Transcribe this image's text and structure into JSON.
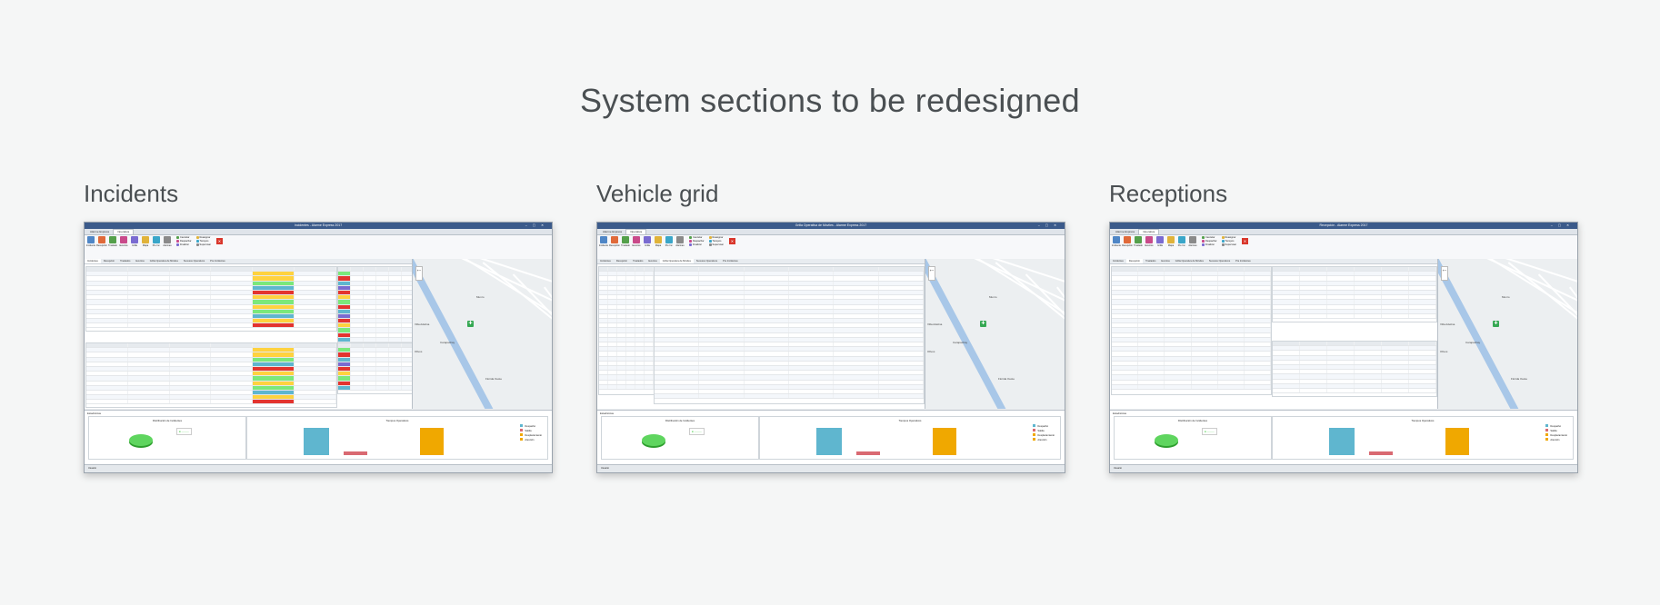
{
  "page_title": "System sections to be redesigned",
  "sections": [
    {
      "label": "Incidents",
      "window_title": "Incidentes - Alarme Express 2017",
      "menu_tabs": [
        "Alarme Express",
        "Operativa"
      ],
      "pane_tabs": [
        "Incidentes",
        "Recepción",
        "Traslados",
        "Eventos",
        "Grilla Operativa de Móviles",
        "Sucesos Operativos",
        "Pre Incidentes"
      ],
      "map_labels": [
        "Villa Adelina",
        "Carapachay",
        "Munro",
        "Florida Oeste",
        "Olivos"
      ],
      "stats_title": "Estadísticas",
      "pie_title": "Distribución de Incidentes",
      "bar_title": "Tiempos Operativos",
      "bar_legend": [
        "Despacho",
        "Salida",
        "Desplazamiento",
        "Atención"
      ],
      "statusbar": "Usuario"
    },
    {
      "label": "Vehicle grid",
      "window_title": "Grilla Operativa de Móviles - Alarme Express 2017",
      "menu_tabs": [
        "Alarme Express",
        "Operativa"
      ],
      "pane_tabs": [
        "Incidentes",
        "Recepción",
        "Traslados",
        "Eventos",
        "Grilla Operativa de Móviles",
        "Sucesos Operativos",
        "Pre Incidentes"
      ],
      "map_labels": [
        "Villa Adelina",
        "Carapachay",
        "Munro",
        "Florida Oeste",
        "Olivos"
      ],
      "stats_title": "Estadísticas",
      "pie_title": "Distribución de Incidentes",
      "bar_title": "Tiempos Operativos",
      "bar_legend": [
        "Despacho",
        "Salida",
        "Desplazamiento",
        "Atención"
      ],
      "statusbar": "Usuario"
    },
    {
      "label": "Receptions",
      "window_title": "Recepción - Alarme Express 2017",
      "menu_tabs": [
        "Alarme Express",
        "Operativa"
      ],
      "pane_tabs": [
        "Incidentes",
        "Recepción",
        "Traslados",
        "Eventos",
        "Grilla Operativa de Móviles",
        "Sucesos Operativos",
        "Pre Incidentes"
      ],
      "map_labels": [
        "Villa Adelina",
        "Carapachay",
        "Munro",
        "Florida Oeste",
        "Olivos"
      ],
      "stats_title": "Estadísticas",
      "pie_title": "Distribución de Incidentes",
      "bar_title": "Tiempos Operativos",
      "bar_legend": [
        "Despacho",
        "Salida",
        "Desplazamiento",
        "Atención"
      ],
      "statusbar": "Usuario"
    }
  ],
  "ribbon": {
    "buttons": [
      "Incidente",
      "Recepción",
      "Traslado",
      "Eventos",
      "Grilla",
      "Mapa",
      "Pre Inc.",
      "Alarmas"
    ],
    "actions": [
      "Cancelar",
      "Despachar",
      "Finalizar",
      "Reasignar",
      "Tiempos",
      "Supervisar"
    ],
    "close_label": "Cerrar Panel"
  },
  "colors": {
    "background": "#f5f6f6",
    "titlebar": "#3b5a8a",
    "bar_despacho": "#5fb6cf",
    "bar_salida": "#d96a72",
    "bar_desplazamiento": "#f0a800",
    "pie": "#5fd55f"
  }
}
